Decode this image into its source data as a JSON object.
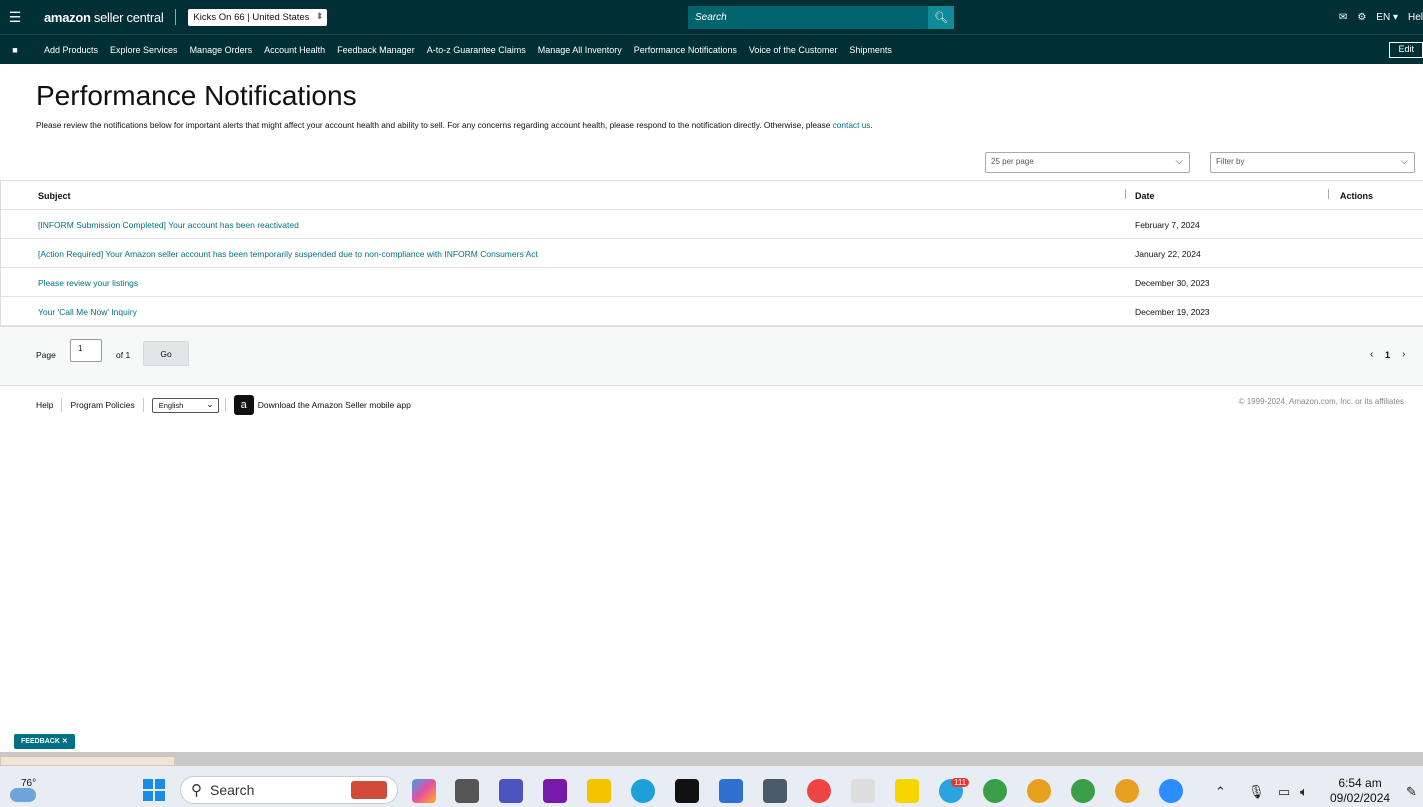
{
  "topbar": {
    "logo_main": "amazon",
    "logo_sub": " seller central",
    "store": "Kicks On 66 | United States",
    "search_placeholder": "Search",
    "lang": "EN ▾",
    "help": "Hel"
  },
  "nav": {
    "items": [
      "Add Products",
      "Explore Services",
      "Manage Orders",
      "Account Health",
      "Feedback Manager",
      "A-to-z Guarantee Claims",
      "Manage All Inventory",
      "Performance Notifications",
      "Voice of the Customer",
      "Shipments"
    ],
    "edit": "Edit"
  },
  "page": {
    "title": "Performance Notifications",
    "subtitle": "Please review the notifications below for important alerts that might affect your account health and ability to sell. For any concerns regarding account health, please respond to the notification directly. Otherwise, please ",
    "contact_link": "contact us",
    "subtitle_end": "."
  },
  "filters": {
    "per_page": "25 per page",
    "filter_by": "Filter by"
  },
  "table": {
    "headers": {
      "subject": "Subject",
      "date": "Date",
      "actions": "Actions"
    },
    "rows": [
      {
        "subject": "[INFORM Submission Completed] Your account has been reactivated",
        "date": "February 7, 2024"
      },
      {
        "subject": "[Action Required] Your Amazon seller account has been temporarily suspended due to non-compliance with INFORM Consumers Act",
        "date": "January 22, 2024"
      },
      {
        "subject": "Please review your listings",
        "date": "December 30, 2023"
      },
      {
        "subject": "Your 'Call Me Now' Inquiry",
        "date": "December 19, 2023"
      }
    ]
  },
  "pager": {
    "page_label": "Page",
    "page_value": "1",
    "of_label": "of 1",
    "go": "Go",
    "current": "1"
  },
  "footer": {
    "help": "Help",
    "policies": "Program Policies",
    "language": "English",
    "app_text": "Download the Amazon Seller mobile app",
    "copyright": "© 1999-2024, Amazon.com, Inc. or its affiliates"
  },
  "feedback": "FEEDBACK ✕",
  "taskbar": {
    "temp": "76°",
    "search": "Search",
    "time": "6:54 am",
    "date": "09/02/2024",
    "badge": "111"
  }
}
